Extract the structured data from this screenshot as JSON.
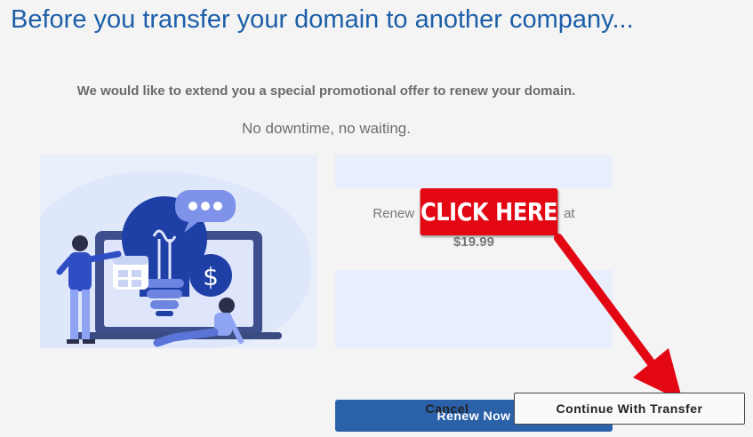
{
  "header": {
    "title": "Before you transfer your domain to another company..."
  },
  "promo": {
    "headline": "We would like to extend you a special promotional offer to renew your domain.",
    "subline": "No downtime, no waiting."
  },
  "offer": {
    "renew_prefix": "Renew",
    "renew_suffix": "at",
    "price": "$19.99",
    "renew_button_label": "Renew Now"
  },
  "annotation": {
    "callout_label": "CLICK HERE",
    "callout_color": "#e30613"
  },
  "footer": {
    "cancel_label": "Cancel",
    "continue_label": "Continue With Transfer"
  },
  "colors": {
    "title": "#1c5fa8",
    "primary_button": "#2a61a9",
    "panel_bg": "#e8eefb"
  },
  "illustration": {
    "icons": [
      "lightbulb-icon",
      "chat-bubble-icon",
      "dollar-coin-icon",
      "calendar-icon"
    ]
  }
}
